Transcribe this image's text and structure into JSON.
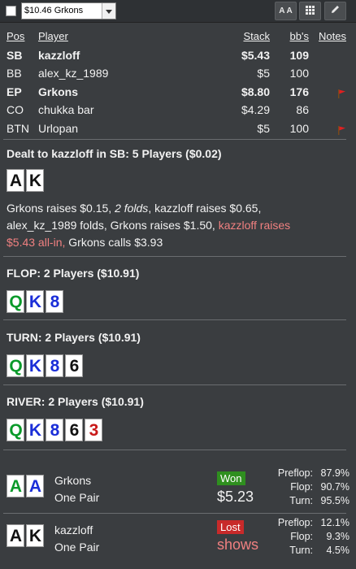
{
  "toolbar": {
    "hand_select": "$10.46 Grkons",
    "font_button": "A A"
  },
  "players": {
    "headers": {
      "pos": "Pos",
      "player": "Player",
      "stack": "Stack",
      "bbs": "bb's",
      "notes": "Notes"
    },
    "rows": [
      {
        "pos": "SB",
        "name": "kazzloff",
        "stack": "$5.43",
        "bbs": "109",
        "bold": true,
        "flag": false
      },
      {
        "pos": "BB",
        "name": "alex_kz_1989",
        "stack": "$5",
        "bbs": "100",
        "bold": false,
        "flag": false
      },
      {
        "pos": "EP",
        "name": "Grkons",
        "stack": "$8.80",
        "bbs": "176",
        "bold": true,
        "flag": true
      },
      {
        "pos": "CO",
        "name": "chukka bar",
        "stack": "$4.29",
        "bbs": "86",
        "bold": false,
        "flag": false
      },
      {
        "pos": "BTN",
        "name": "Urlopan",
        "stack": "$5",
        "bbs": "100",
        "bold": false,
        "flag": true
      }
    ]
  },
  "preflop": {
    "title": "Dealt to kazzloff in SB: 5 Players ($0.02)",
    "cards": [
      "A",
      "K"
    ],
    "actions": {
      "a1": "Grkons raises $0.15, ",
      "a2": "2 folds",
      "a3": ", kazzloff raises $0.65,",
      "a4": "alex_kz_1989 folds, Grkons raises $1.50, ",
      "a5": "kazzloff raises",
      "a6": "$5.43 all-in,",
      "a7": " Grkons calls $3.93"
    }
  },
  "flop": {
    "title": "FLOP: 2 Players ($10.91)",
    "cards": [
      "Q",
      "K",
      "8"
    ]
  },
  "turn": {
    "title": "TURN: 2 Players ($10.91)",
    "cards": [
      "Q",
      "K",
      "8",
      "6"
    ]
  },
  "river": {
    "title": "RIVER: 2 Players ($10.91)",
    "cards": [
      "Q",
      "K",
      "8",
      "6",
      "3"
    ]
  },
  "showdown": [
    {
      "cards": [
        "A",
        "A"
      ],
      "name": "Grkons",
      "hand": "One Pair",
      "result": "Won",
      "amount": "$5.23",
      "stats": {
        "preflop_label": "Preflop:",
        "preflop": "87.9%",
        "flop_label": "Flop:",
        "flop": "90.7%",
        "turn_label": "Turn:",
        "turn": "95.5%"
      }
    },
    {
      "cards": [
        "A",
        "K"
      ],
      "name": "kazzloff",
      "hand": "One Pair",
      "result": "Lost",
      "amount": "shows",
      "stats": {
        "preflop_label": "Preflop:",
        "preflop": "12.1%",
        "flop_label": "Flop:",
        "flop": "9.3%",
        "turn_label": "Turn:",
        "turn": "4.5%"
      }
    }
  ],
  "colors": {
    "background": "#3a3d40",
    "won": "#2f8f1f",
    "lost": "#c82a2a",
    "highlight": "#f08080"
  }
}
